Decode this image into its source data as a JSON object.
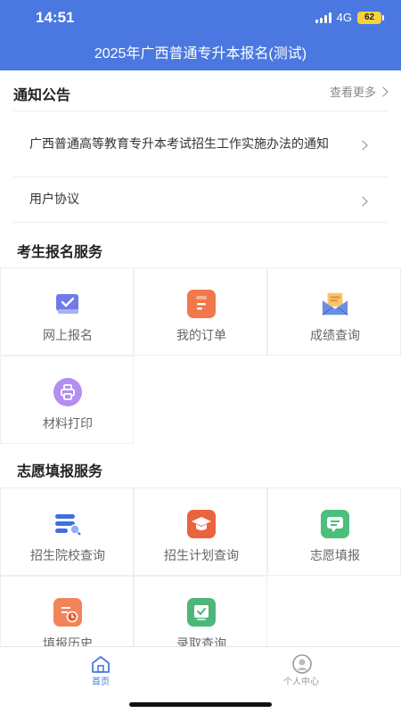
{
  "status": {
    "time": "14:51",
    "network": "4G",
    "battery": "62"
  },
  "header": {
    "title": "2025年广西普通专升本报名(测试)"
  },
  "notice": {
    "title": "通知公告",
    "more": "查看更多",
    "items": [
      {
        "text": "广西普通高等教育专升本考试招生工作实施办法的通知"
      },
      {
        "text": "用户协议"
      }
    ]
  },
  "exam_services": {
    "title": "考生报名服务",
    "items": [
      {
        "label": "网上报名",
        "icon": "online-register-icon"
      },
      {
        "label": "我的订单",
        "icon": "order-icon"
      },
      {
        "label": "成绩查询",
        "icon": "score-envelope-icon"
      },
      {
        "label": "材料打印",
        "icon": "print-icon"
      }
    ]
  },
  "volunteer_services": {
    "title": "志愿填报服务",
    "items": [
      {
        "label": "招生院校查询",
        "icon": "school-search-icon"
      },
      {
        "label": "招生计划查询",
        "icon": "graduation-cap-icon"
      },
      {
        "label": "志愿填报",
        "icon": "chat-form-icon"
      },
      {
        "label": "填报历史",
        "icon": "history-icon"
      },
      {
        "label": "录取查询",
        "icon": "admission-check-icon"
      }
    ]
  },
  "tabbar": {
    "items": [
      {
        "label": "首页",
        "icon": "home-icon",
        "active": true
      },
      {
        "label": "个人中心",
        "icon": "user-center-icon",
        "active": false
      }
    ]
  },
  "colors": {
    "primary": "#4a78e0",
    "order": "#f0784a",
    "print": "#b38ff0",
    "cap": "#e9643c",
    "chat": "#4cbf7c",
    "admission": "#4fb67a"
  }
}
